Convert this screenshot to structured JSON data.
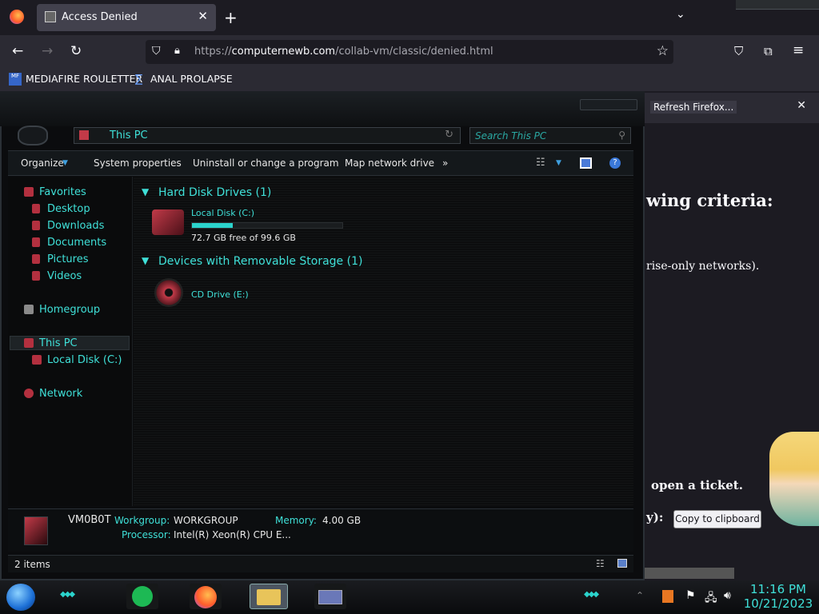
{
  "browser": {
    "tab_title": "Access Denied",
    "url_prefix": "https://",
    "url_domain": "computernewb.com",
    "url_path": "/collab-vm/classic/denied.html",
    "bookmarks": [
      "MEDIAFIRE ROULETTER",
      "ANAL PROLAPSE"
    ]
  },
  "notification": {
    "text": "Refresh Firefox..."
  },
  "page": {
    "heading": "wing criteria:",
    "line1": "rise-only networks).",
    "line2": "open a ticket.",
    "line3_prefix": "y):",
    "copy_button": "Copy to clipboard"
  },
  "explorer": {
    "address": "This PC",
    "search_placeholder": "Search This PC",
    "commands": [
      "Organize",
      "System properties",
      "Uninstall or change a program",
      "Map network drive",
      "»"
    ],
    "nav": {
      "favorites": "Favorites",
      "desktop": "Desktop",
      "downloads": "Downloads",
      "documents": "Documents",
      "pictures": "Pictures",
      "videos": "Videos",
      "homegroup": "Homegroup",
      "thispc": "This PC",
      "localdisk": "Local Disk (C:)",
      "network": "Network"
    },
    "groups": {
      "hdd": "Hard Disk Drives (1)",
      "removable": "Devices with Removable Storage (1)"
    },
    "drives": {
      "c_label": "Local Disk (C:)",
      "c_free": "72.7 GB free of 99.6 GB",
      "c_used_fraction": 0.27,
      "e_label": "CD Drive (E:)"
    },
    "details": {
      "computer_name": "VM0B0T",
      "workgroup_label": "Workgroup:",
      "workgroup": "WORKGROUP",
      "memory_label": "Memory:",
      "memory": "4.00 GB",
      "processor_label": "Processor:",
      "processor": "Intel(R) Xeon(R) CPU E..."
    },
    "status": "2 items"
  },
  "taskbar": {
    "time": "11:16 PM",
    "date": "10/21/2023"
  },
  "colors": {
    "accent": "#3fe0d8",
    "browser_bg": "#1c1b22"
  }
}
